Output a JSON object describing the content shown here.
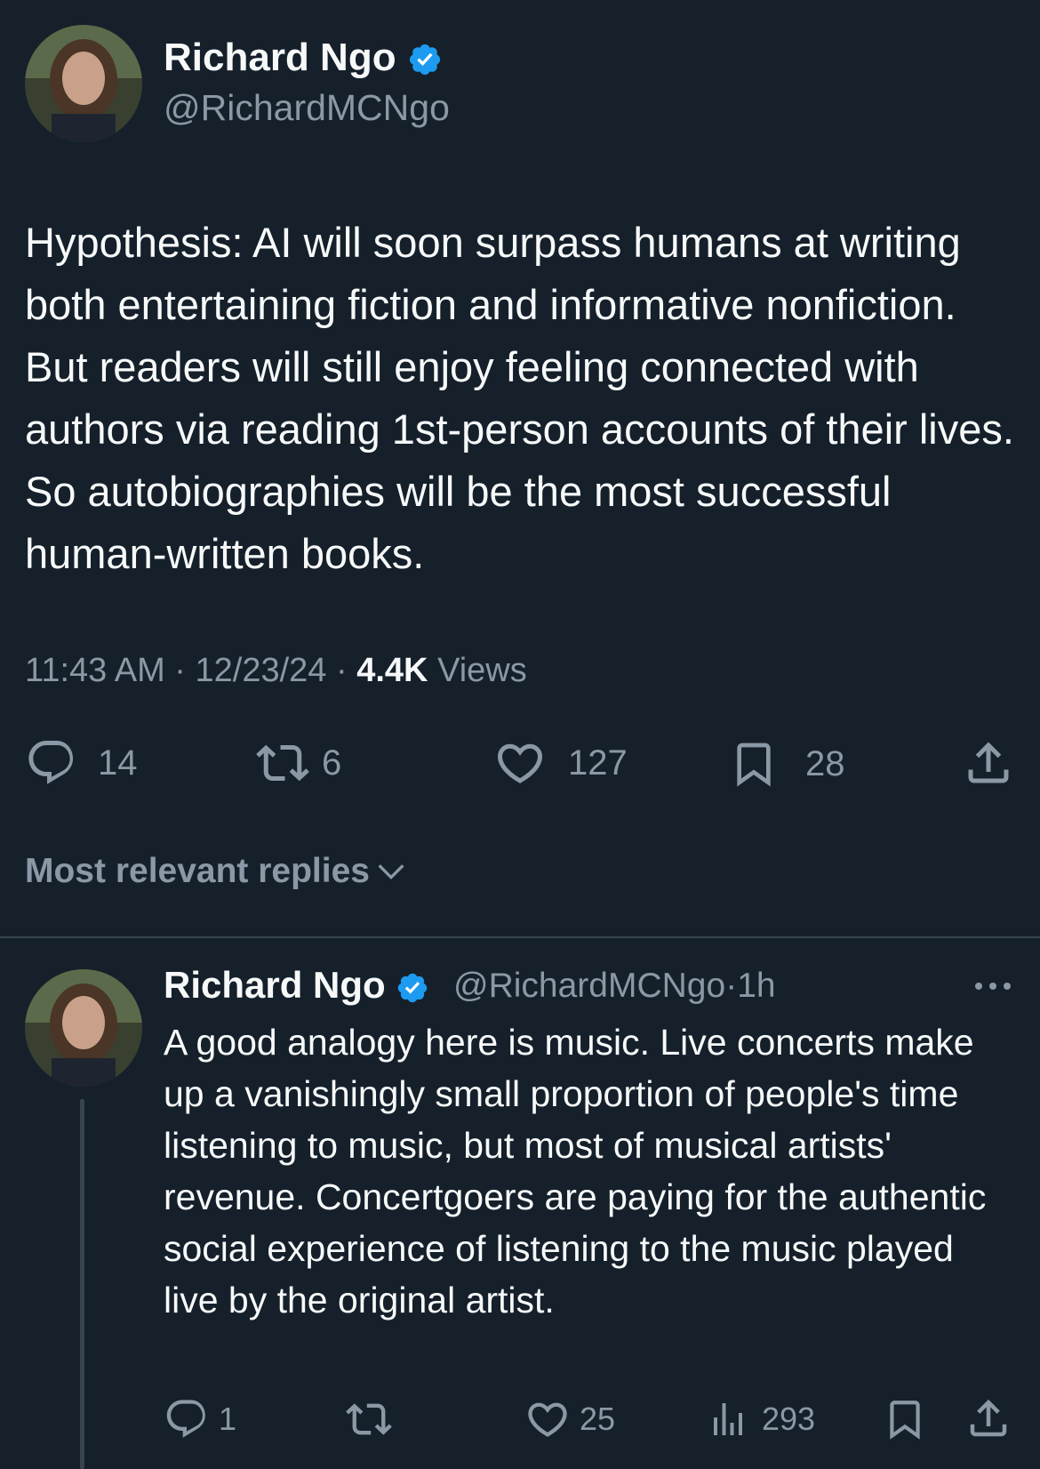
{
  "tweet": {
    "author_name": "Richard Ngo",
    "handle": "@RichardMCNgo",
    "text": "Hypothesis: AI will soon surpass humans at writing both entertaining fiction and informative nonfiction. But readers will still enjoy feeling connected with authors via reading 1st-person accounts of their lives. So autobiographies will be the most successful human-written books.",
    "time": "11:43 AM",
    "date": "12/23/24",
    "views_count": "4.4K",
    "views_label": "Views",
    "replies": "14",
    "reposts": "6",
    "likes": "127",
    "bookmarks": "28"
  },
  "replies_section": {
    "label": "Most relevant replies"
  },
  "reply": {
    "author_name": "Richard Ngo",
    "handle": "@RichardMCNgo",
    "age": "1h",
    "text": "A good analogy here is music. Live concerts make up a vanishingly small proportion of people's time listening to music, but most of musical artists' revenue. Concertgoers are paying for the authentic social experience of listening to the music played live by the original artist.",
    "replies": "1",
    "likes": "25",
    "views": "293"
  },
  "colors": {
    "background": "#15202b",
    "text": "#f7f9f9",
    "secondary": "#8b98a5",
    "verified": "#1d9bf0",
    "divider": "#38444d"
  },
  "icons": [
    "verified-badge-icon",
    "reply-icon",
    "repost-icon",
    "like-icon",
    "bookmark-icon",
    "share-icon",
    "chevron-down-icon",
    "more-icon",
    "views-icon"
  ]
}
